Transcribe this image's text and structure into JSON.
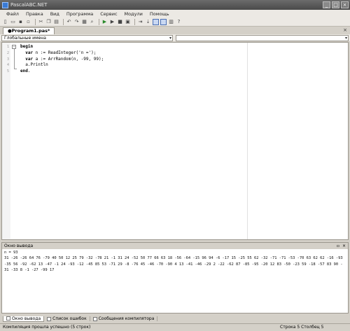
{
  "window": {
    "title": "PascalABC.NET"
  },
  "menu": [
    "Файл",
    "Правка",
    "Вид",
    "Программа",
    "Сервис",
    "Модули",
    "Помощь"
  ],
  "toolbar": {
    "icons": [
      "new-file-icon",
      "open-icon",
      "save-icon",
      "save-all-icon",
      "cut-icon",
      "copy-icon",
      "paste-icon",
      "undo-icon",
      "redo-icon",
      "print-icon",
      "find-icon",
      "run-icon",
      "debug-icon",
      "stop-icon",
      "compile-icon",
      "step-over-icon",
      "step-into-icon",
      "layout-1-icon",
      "layout-2-icon",
      "format-icon",
      "help-icon"
    ]
  },
  "editor_tab": {
    "label": "●Program1.pas*",
    "close": "×"
  },
  "dropdowns": {
    "left": "Глобальные имена",
    "right": ""
  },
  "code": {
    "line_numbers": [
      "1",
      "2",
      "3",
      "4",
      "5"
    ],
    "lines": [
      {
        "kw": "begin",
        "rest": ""
      },
      {
        "kw": "  var",
        "rest": " n := ReadInteger('n =');"
      },
      {
        "kw": "  var",
        "rest": " a := ArrRandom(n, -99, 99);"
      },
      {
        "kw": "",
        "rest": "  a.Println"
      },
      {
        "kw": "end",
        "rest": "."
      }
    ]
  },
  "output": {
    "header": "Окно вывода",
    "text": "n = 93\n31 -26 -26 64 76 -79 40 50 12 25 79 -32 -78 21 -1 31 24 -52 50 77 66 63 18 -56 -64 -15 96 94 -6 -17 15 -25 55 62 -32 -71 -71 -53 -70 63 62 62 -16 -93 -35 56 -92 -62 13 -47 -1 24 -93 -12 -45 85 53 -71 29 -8 -76 45 -46 -70 -90 4 13 -41 -46 -29 2 -22 -62 87 -85 -95 -20 12 83 -50 -23 59 -18 -57 83 90 -31 -33 8 -1 -27 -99 17"
  },
  "bottom_tabs": [
    "Окно вывода",
    "Список ошибок",
    "Сообщения компилятора"
  ],
  "status": {
    "message": "Компиляция прошла успешно (5 строк)",
    "position": "Строка  5  Столбец  5"
  }
}
